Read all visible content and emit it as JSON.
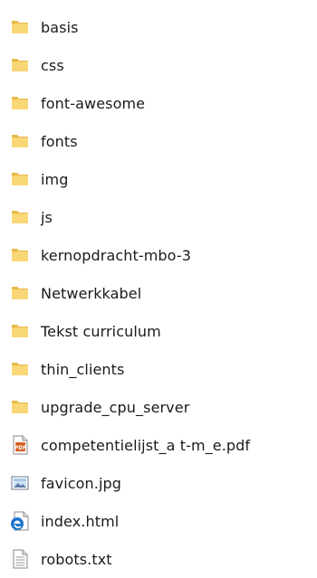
{
  "folders": [
    {
      "name": "basis",
      "icon": "folder-icon"
    },
    {
      "name": "css",
      "icon": "folder-icon"
    },
    {
      "name": "font-awesome",
      "icon": "folder-icon"
    },
    {
      "name": "fonts",
      "icon": "folder-icon"
    },
    {
      "name": "img",
      "icon": "folder-icon"
    },
    {
      "name": "js",
      "icon": "folder-icon"
    },
    {
      "name": "kernopdracht-mbo-3",
      "icon": "folder-icon"
    },
    {
      "name": "Netwerkkabel",
      "icon": "folder-icon"
    },
    {
      "name": "Tekst curriculum",
      "icon": "folder-icon"
    },
    {
      "name": "thin_clients",
      "icon": "folder-icon"
    },
    {
      "name": "upgrade_cpu_server",
      "icon": "folder-icon"
    }
  ],
  "files": [
    {
      "name": "competentielijst_a t-m_e.pdf",
      "icon": "pdf-file-icon"
    },
    {
      "name": "favicon.jpg",
      "icon": "image-file-icon"
    },
    {
      "name": "index.html",
      "icon": "edge-html-file-icon"
    },
    {
      "name": "robots.txt",
      "icon": "text-file-icon"
    }
  ],
  "colors": {
    "folder_back": "#e8b949",
    "folder_front": "#f9d776",
    "pdf_accent": "#d65f1f",
    "edge_blue": "#1b75d0"
  }
}
